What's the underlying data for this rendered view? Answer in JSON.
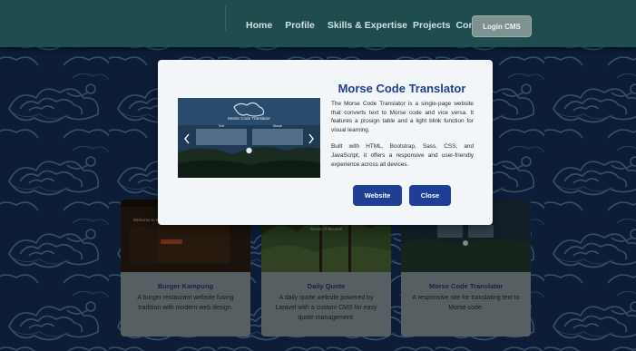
{
  "nav": {
    "links": [
      "Home",
      "Profile",
      "Skills & Expertise",
      "Projects",
      "Contact"
    ],
    "login_label": "Login CMS"
  },
  "cards": [
    {
      "title": "Burger Kampung",
      "description": "A burger restaurant website fusing tradition with modern web design.",
      "thumb_caption": "Welcome to Burger Kampung"
    },
    {
      "title": "Daily Quote",
      "description": "A daily quote website powered by Laravel with a custom CMS for easy quote management.",
      "thumb_caption": "Words of Wisdom"
    },
    {
      "title": "Morse Code Translator",
      "description": "A responsive site for translating text to Morse code.",
      "thumb_caption": ""
    }
  ],
  "modal": {
    "title": "Morse Code Translator",
    "paragraph1": "The Morse Code Translator is a single-page website that converts text to Morse code and vice versa. It features a prosign table and a light blink function for visual learning.",
    "paragraph2": "Built with HTML, Bootstrap, Sass, CSS, and JavaScript, it offers a responsive and user-friendly experience across all devices.",
    "website_label": "Website",
    "close_label": "Close",
    "preview": {
      "app_title": "Morse Code Translator",
      "left_label": "Text",
      "right_label": "Morse"
    }
  },
  "colors": {
    "navbar": "#1f4d4f",
    "accent": "#1f3f96",
    "modal_bg": "#f3f6f8",
    "background": "#16305a"
  }
}
